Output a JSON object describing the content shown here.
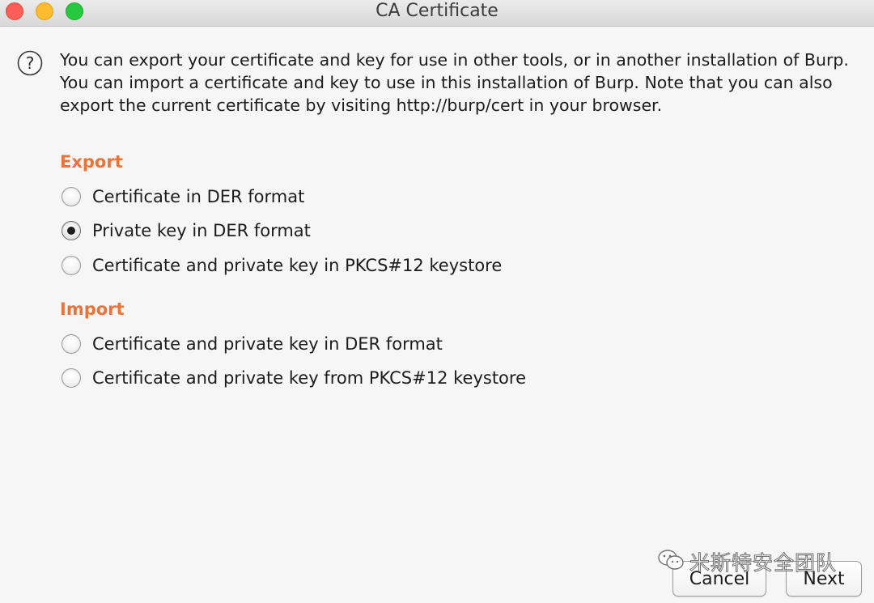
{
  "window": {
    "title": "CA Certificate"
  },
  "intro": {
    "icon": "question-circle-icon",
    "text": "You can export your certificate and key for use in other tools, or in another installation of Burp. You can import a certificate and key to use in this installation of Burp. Note that you can also export the current certificate by visiting http://burp/cert in your browser."
  },
  "export": {
    "label": "Export",
    "options": [
      {
        "label": "Certificate in DER format",
        "checked": false
      },
      {
        "label": "Private key in DER format",
        "checked": true
      },
      {
        "label": "Certificate and private key in PKCS#12 keystore",
        "checked": false
      }
    ]
  },
  "import": {
    "label": "Import",
    "options": [
      {
        "label": "Certificate and private key in DER format",
        "checked": false
      },
      {
        "label": "Certificate and private key from PKCS#12 keystore",
        "checked": false
      }
    ]
  },
  "buttons": {
    "cancel": "Cancel",
    "next": "Next"
  },
  "watermark": {
    "text": "米斯特安全团队",
    "icon": "wechat-icon"
  },
  "colors": {
    "section_label": "#e8743b",
    "close": "#fc5f57",
    "minimize": "#fdbc2e",
    "zoom": "#28c840"
  }
}
